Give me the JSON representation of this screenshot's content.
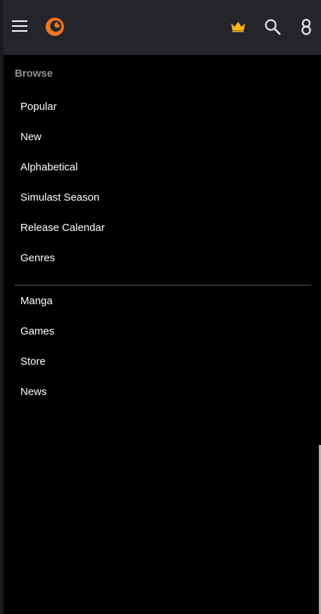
{
  "header": {
    "menu_icon": "hamburger-icon",
    "logo_icon": "crunchyroll-logo-icon",
    "premium_icon": "crown-icon",
    "search_icon": "search-icon",
    "account_icon": "user-icon",
    "accent_color": "#f47521",
    "premium_color": "#f8b719"
  },
  "menu": {
    "section_title": "Browse",
    "primary_items": [
      {
        "label": "Popular"
      },
      {
        "label": "New"
      },
      {
        "label": "Alphabetical"
      },
      {
        "label": "Simulast Season"
      },
      {
        "label": "Release Calendar"
      },
      {
        "label": "Genres"
      }
    ],
    "secondary_items": [
      {
        "label": "Manga"
      },
      {
        "label": "Games"
      },
      {
        "label": "Store"
      },
      {
        "label": "News"
      }
    ]
  }
}
